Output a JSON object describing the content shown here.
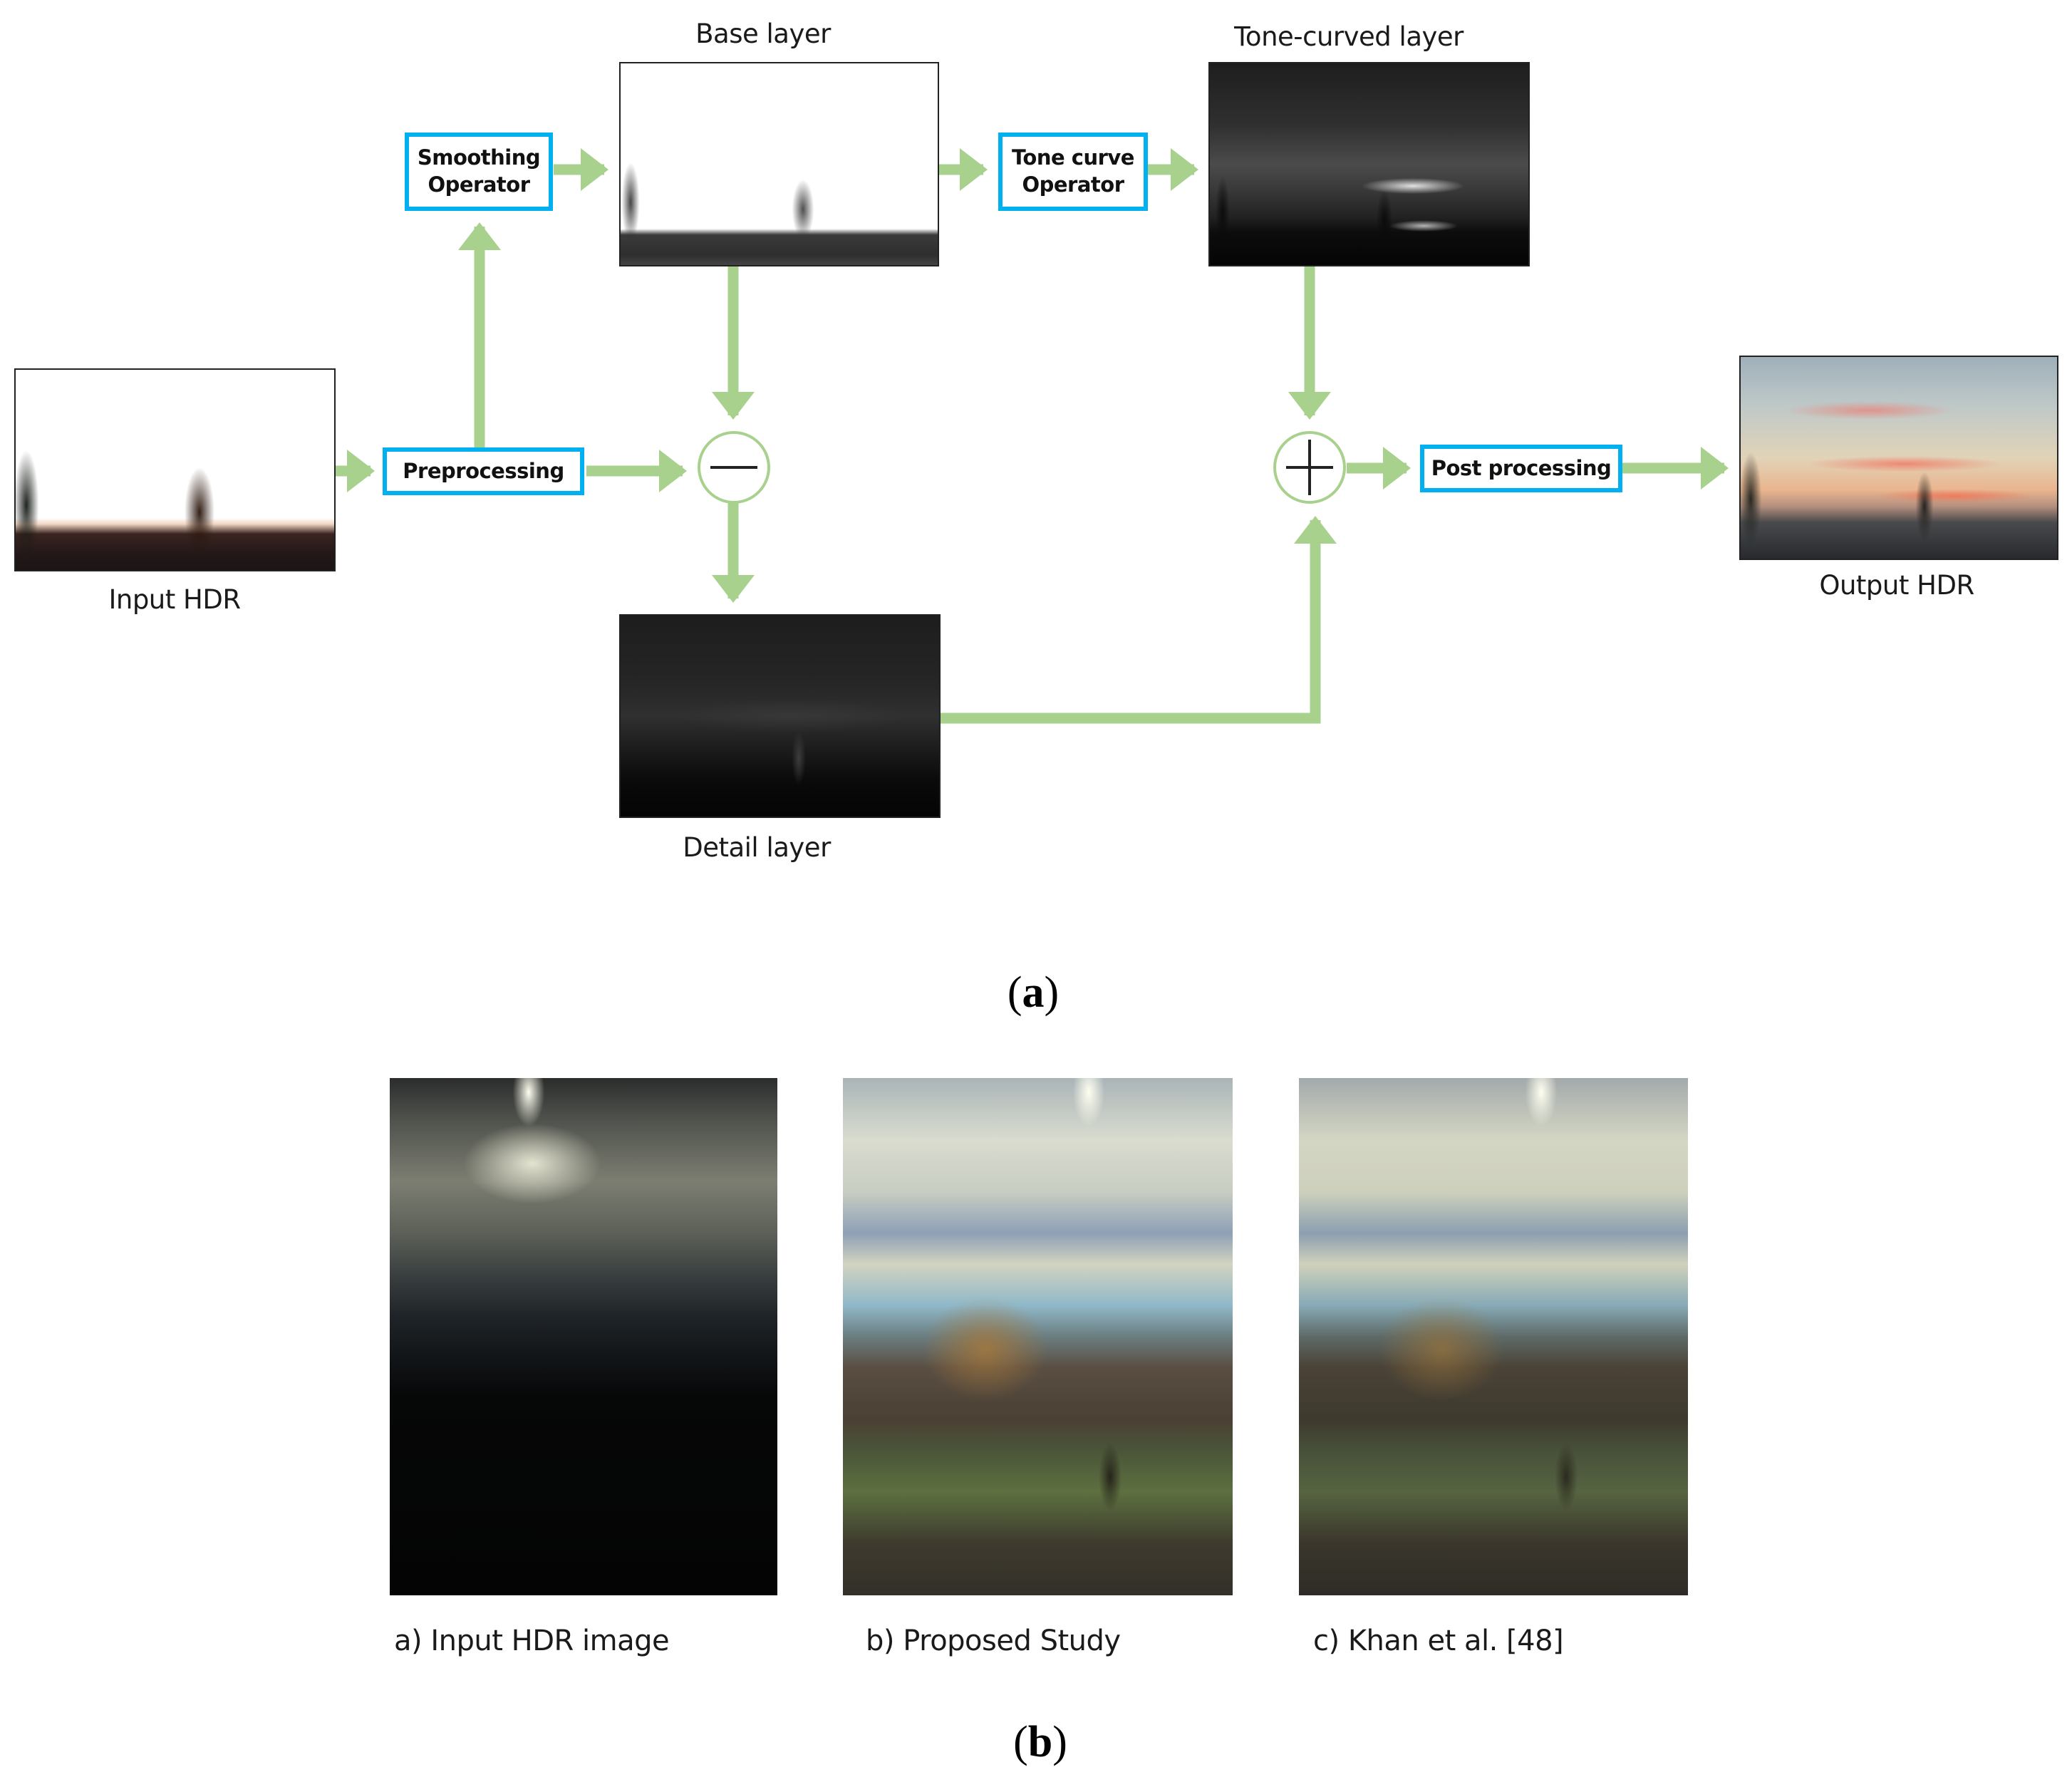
{
  "figure_a": {
    "caption_open": "(",
    "caption_letter": "a",
    "caption_close": ")",
    "images": {
      "input_hdr": {
        "label": "Input HDR"
      },
      "base_layer": {
        "label": "Base layer"
      },
      "tone_curved_layer": {
        "label": "Tone-curved layer"
      },
      "detail_layer": {
        "label": "Detail layer"
      },
      "output_hdr": {
        "label": "Output HDR"
      }
    },
    "operators": {
      "smoothing": {
        "line1": "Smoothing",
        "line2": "Operator"
      },
      "tone_curve": {
        "line1": "Tone curve",
        "line2": "Operator"
      },
      "preprocessing": {
        "label": "Preprocessing"
      },
      "post_processing": {
        "label": "Post processing"
      }
    },
    "junctions": {
      "subtract": {
        "symbol": "minus-icon"
      },
      "add": {
        "symbol": "plus-icon"
      }
    },
    "colors": {
      "arrow": "#a9d18e",
      "box_border": "#00b0f0"
    }
  },
  "figure_b": {
    "caption_open": "(",
    "caption_letter": "b",
    "caption_close": ")",
    "panels": [
      {
        "label": "a) Input HDR image"
      },
      {
        "label": "b) Proposed Study"
      },
      {
        "label": "c) Khan et al. [48]"
      }
    ]
  }
}
